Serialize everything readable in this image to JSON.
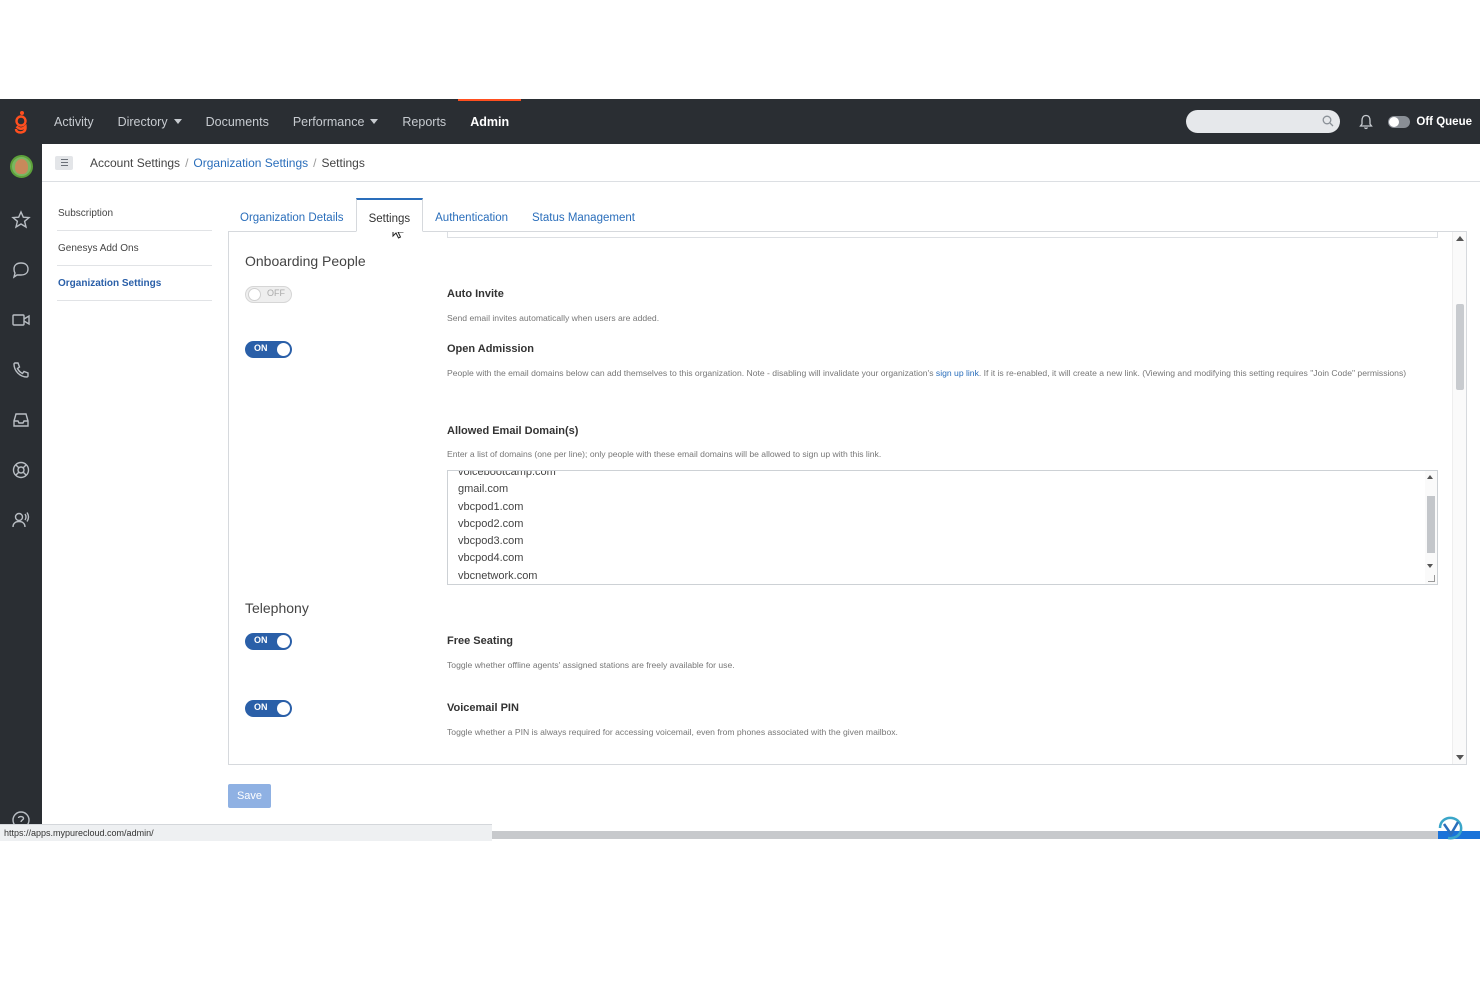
{
  "topnav": {
    "items": [
      {
        "label": "Activity"
      },
      {
        "label": "Directory"
      },
      {
        "label": "Documents"
      },
      {
        "label": "Performance"
      },
      {
        "label": "Reports"
      },
      {
        "label": "Admin"
      }
    ],
    "queue_label": "Off Queue",
    "brand_color": "#ff4f1f"
  },
  "breadcrumb": {
    "items": [
      "Account Settings",
      "Organization Settings",
      "Settings"
    ]
  },
  "subnav": {
    "items": [
      "Subscription",
      "Genesys Add Ons",
      "Organization Settings"
    ]
  },
  "tabs": [
    "Organization Details",
    "Settings",
    "Authentication",
    "Status Management"
  ],
  "sections": {
    "onboarding": {
      "title": "Onboarding People",
      "auto_invite": {
        "toggle": "OFF",
        "title": "Auto Invite",
        "desc": "Send email invites automatically when users are added."
      },
      "open_admission": {
        "toggle": "ON",
        "title": "Open Admission",
        "desc_before": "People with the email domains below can add themselves to this organization. Note - disabling will invalidate your organization's ",
        "desc_link": "sign up link",
        "desc_after": ". If it is re-enabled, it will create a new link. (Viewing and modifying this setting requires \"Join Code\" permissions)"
      },
      "allowed_domains": {
        "title": "Allowed Email Domain(s)",
        "desc": "Enter a list of domains (one per line); only people with these email domains will be allowed to sign up with this link.",
        "domains": [
          "voicebootcamp.com",
          "gmail.com",
          "vbcpod1.com",
          "vbcpod2.com",
          "vbcpod3.com",
          "vbcpod4.com",
          "vbcnetwork.com"
        ]
      }
    },
    "telephony": {
      "title": "Telephony",
      "free_seating": {
        "toggle": "ON",
        "title": "Free Seating",
        "desc": "Toggle whether offline agents' assigned stations are freely available for use."
      },
      "voicemail_pin": {
        "toggle": "ON",
        "title": "Voicemail PIN",
        "desc": "Toggle whether a PIN is always required for accessing voicemail, even from phones associated with the given mailbox."
      }
    }
  },
  "save_label": "Save",
  "status_url": "https://apps.mypurecloud.com/admin/"
}
